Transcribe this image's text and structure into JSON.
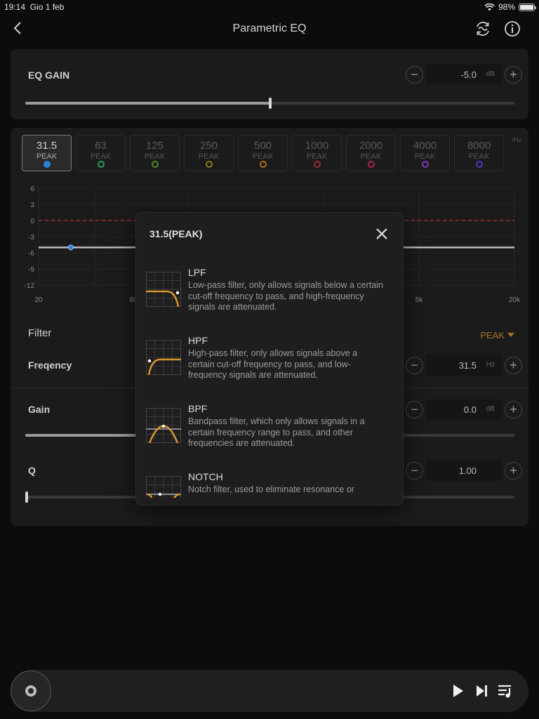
{
  "status": {
    "time": "19:14",
    "date": "Gio 1 feb",
    "battery": "98%",
    "battery_level": 0.98
  },
  "header": {
    "title": "Parametric EQ"
  },
  "eq_gain": {
    "label": "EQ GAIN",
    "value": "-5.0",
    "unit": "dB",
    "slider_level": 0.5
  },
  "bands": {
    "unit": "/Hz",
    "items": [
      {
        "freq": "31.5",
        "type": "PEAK",
        "color": "#2f7fe0",
        "active": true
      },
      {
        "freq": "63",
        "type": "PEAK",
        "color": "#2f9a5a"
      },
      {
        "freq": "125",
        "type": "PEAK",
        "color": "#4f8a2a"
      },
      {
        "freq": "250",
        "type": "PEAK",
        "color": "#8a7a1a"
      },
      {
        "freq": "500",
        "type": "PEAK",
        "color": "#b06a1a"
      },
      {
        "freq": "1000",
        "type": "PEAK",
        "color": "#a02a2a"
      },
      {
        "freq": "2000",
        "type": "PEAK",
        "color": "#b0205a"
      },
      {
        "freq": "4000",
        "type": "PEAK",
        "color": "#7a3ac0"
      },
      {
        "freq": "8000",
        "type": "PEAK",
        "color": "#4a3ac0"
      }
    ]
  },
  "graph": {
    "y_ticks": [
      "6",
      "3",
      "0",
      "-3",
      "-6",
      "-9",
      "-12"
    ],
    "x_ticks": [
      "20",
      "80",
      "5k",
      "20k"
    ],
    "curve_level_db": -5.0,
    "zero_line_color": "#c0303a"
  },
  "filter": {
    "label": "Filter",
    "value": "PEAK"
  },
  "frequency": {
    "label": "Freqency",
    "value": "31.5",
    "unit": "Hz"
  },
  "gain": {
    "label": "Gain",
    "value": "0.0",
    "unit": "dB",
    "slider_level": 0.5
  },
  "q": {
    "label": "Q",
    "value": "1.00",
    "slider_level": 0.0
  },
  "modal": {
    "title": "31.5(PEAK)",
    "options": [
      {
        "name": "LPF",
        "desc": "Low-pass filter, only allows signals below a certain cut-off frequency to pass, and high-frequency signals are attenuated."
      },
      {
        "name": "HPF",
        "desc": "High-pass filter, only allows signals above a certain cut-off frequency to pass, and low-frequency signals are attenuated."
      },
      {
        "name": "BPF",
        "desc": "Bandpass filter, which only allows signals in a certain frequency range to pass, and other frequencies are attenuated."
      },
      {
        "name": "NOTCH",
        "desc": "Notch filter, used to eliminate resonance or"
      }
    ]
  },
  "colors": {
    "accent_orange": "#a8702a",
    "curve_orange": "#d9962e",
    "background": "#0c0c0c",
    "panel": "#1b1b1b"
  },
  "icons": {
    "back": "chevron-left-icon",
    "sync": "sync-wave-icon",
    "info": "info-icon",
    "close": "close-icon",
    "play": "play-icon",
    "next": "skip-next-icon",
    "queue": "queue-icon",
    "disc": "disc-icon"
  }
}
